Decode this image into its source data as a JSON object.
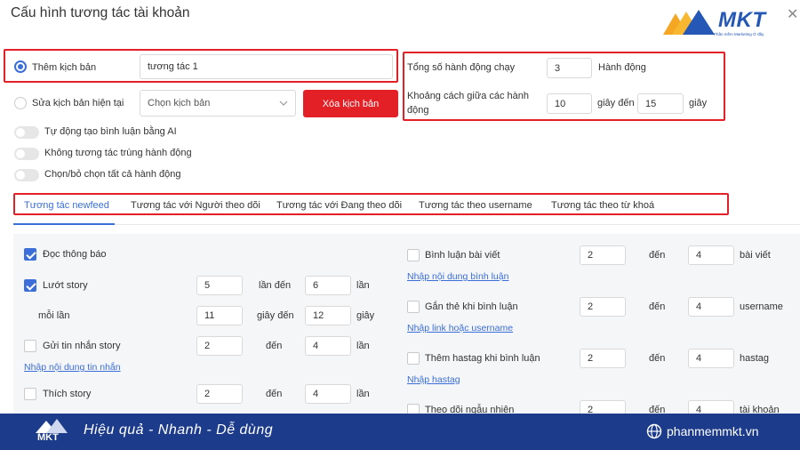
{
  "dialog": {
    "title": "Cấu hình tương tác tài khoản"
  },
  "brand": {
    "logo": "MKT",
    "logo_sub": "Phần mềm Marketing Ở đây"
  },
  "icons": {
    "close": "close-icon",
    "chevron": "chevron-down-icon",
    "globe": "globe-icon"
  },
  "colors": {
    "accent": "#3b6ed8",
    "danger": "#e42027",
    "footer": "#1d3b8b"
  },
  "scenario": {
    "add_label": "Thêm kịch bản",
    "add_value": "tương tác 1",
    "edit_label": "Sửa kịch bản hiện tại",
    "select_placeholder": "Chọn kịch bản",
    "delete_button": "Xóa kịch bản"
  },
  "toggles": [
    {
      "label": "Tự động tạo bình luận bằng AI",
      "on": false
    },
    {
      "label": "Không tương tác trùng hành động",
      "on": false
    },
    {
      "label": "Chọn/bỏ chọn tất cả hành động",
      "on": false
    }
  ],
  "actions": {
    "total_label": "Tổng số hành động chạy",
    "total_value": "3",
    "total_unit": "Hành động",
    "gap_label_1": "Khoảng cách giữa các hành",
    "gap_label_2": "động",
    "gap_from": "10",
    "gap_mid": "giây đến",
    "gap_to": "15",
    "gap_unit": "giây"
  },
  "tabs": [
    "Tương tác newfeed",
    "Tương tác với Người theo dõi",
    "Tương tác với Đang theo dõi",
    "Tương tác theo username",
    "Tương tác theo từ khoá"
  ],
  "left": {
    "read_notif": "Đọc thông báo",
    "scroll_story": "Lướt story",
    "scroll_from": "5",
    "scroll_mid": "lần đến",
    "scroll_to": "6",
    "scroll_unit": "lần",
    "each_label": "mỗi lần",
    "each_from": "11",
    "each_mid": "giây đến",
    "each_to": "12",
    "each_unit": "giây",
    "msg_story": "Gửi tin nhắn story",
    "msg_from": "2",
    "msg_mid": "đến",
    "msg_to": "4",
    "msg_unit": "lần",
    "msg_link": "Nhập nội dung tin nhắn",
    "like_story": "Thích story",
    "like_from": "2",
    "like_mid": "đến",
    "like_to": "4",
    "like_unit": "lần"
  },
  "right": {
    "comment": "Bình luận bài viết",
    "comment_from": "2",
    "comment_mid": "đến",
    "comment_to": "4",
    "comment_unit": "bài viết",
    "comment_link": "Nhập nội dung bình luận",
    "tag": "Gắn thẻ khi bình luận",
    "tag_from": "2",
    "tag_mid": "đến",
    "tag_to": "4",
    "tag_unit": "username",
    "tag_link": "Nhập link hoặc username",
    "hashtag": "Thêm hastag khi bình luận",
    "hashtag_from": "2",
    "hashtag_mid": "đến",
    "hashtag_to": "4",
    "hashtag_unit": "hastag",
    "hashtag_link": "Nhập hastag",
    "follow": "Theo dõi ngẫu nhiên",
    "follow_from": "2",
    "follow_mid": "đến",
    "follow_to": "4",
    "follow_unit": "tài khoản"
  },
  "footer": {
    "logo": "MKT",
    "tagline": "Hiệu quả - Nhanh - Dễ dùng",
    "website": "phanmemmkt.vn"
  }
}
